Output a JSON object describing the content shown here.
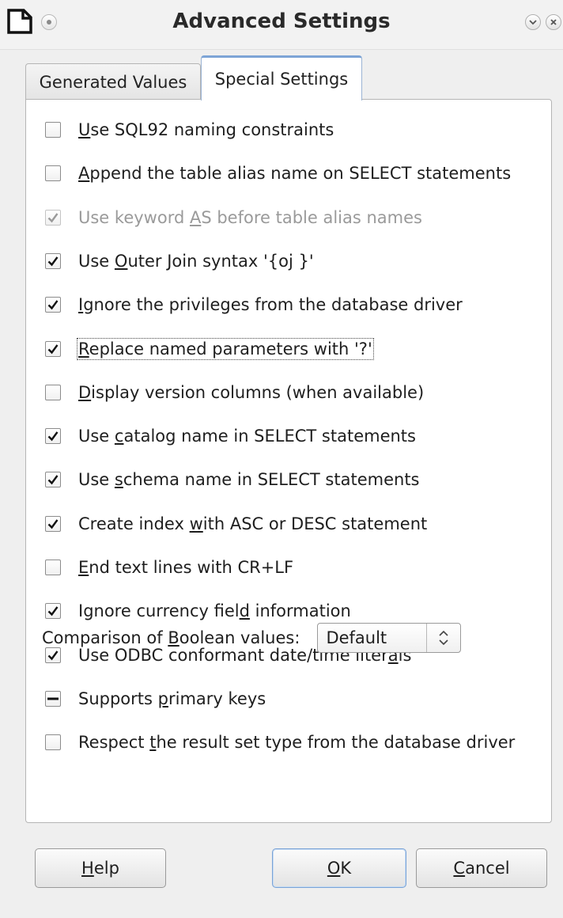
{
  "window": {
    "title": "Advanced Settings",
    "icons": {
      "app": "document-icon",
      "menu": "window-menu-icon",
      "minimize": "chevron-down-icon",
      "close": "close-icon"
    }
  },
  "tabs": [
    {
      "label": "Generated Values",
      "active": false
    },
    {
      "label": "Special Settings",
      "active": true
    }
  ],
  "settings": [
    {
      "label": "Use SQL92 naming constraints",
      "state": "unchecked",
      "enabled": true
    },
    {
      "label": "Append the table alias name on SELECT statements",
      "state": "unchecked",
      "enabled": true
    },
    {
      "label": "Use keyword AS before table alias names",
      "state": "checked",
      "enabled": false
    },
    {
      "label": "Use Outer Join syntax '{oj }'",
      "state": "checked",
      "enabled": true
    },
    {
      "label": "Ignore the privileges from the database driver",
      "state": "checked",
      "enabled": true
    },
    {
      "label": "Replace named parameters with '?'",
      "state": "checked",
      "enabled": true,
      "focused": true
    },
    {
      "label": "Display version columns (when available)",
      "state": "unchecked",
      "enabled": true
    },
    {
      "label": "Use catalog name in SELECT statements",
      "state": "checked",
      "enabled": true
    },
    {
      "label": "Use schema name in SELECT statements",
      "state": "checked",
      "enabled": true
    },
    {
      "label": "Create index with ASC or DESC statement",
      "state": "checked",
      "enabled": true
    },
    {
      "label": "End text lines with CR+LF",
      "state": "unchecked",
      "enabled": true
    },
    {
      "label": "Ignore currency field information",
      "state": "checked",
      "enabled": true
    },
    {
      "label": "Use ODBC conformant date/time literals",
      "state": "checked",
      "enabled": true
    },
    {
      "label": "Supports primary keys",
      "state": "indeterminate",
      "enabled": true
    },
    {
      "label": "Respect the result set type from the database driver",
      "state": "unchecked",
      "enabled": true
    }
  ],
  "comparison": {
    "label": "Comparison of Boolean values:",
    "value": "Default",
    "icon": "spin-updown-icon"
  },
  "buttons": {
    "help": "Help",
    "ok": "OK",
    "cancel": "Cancel"
  }
}
